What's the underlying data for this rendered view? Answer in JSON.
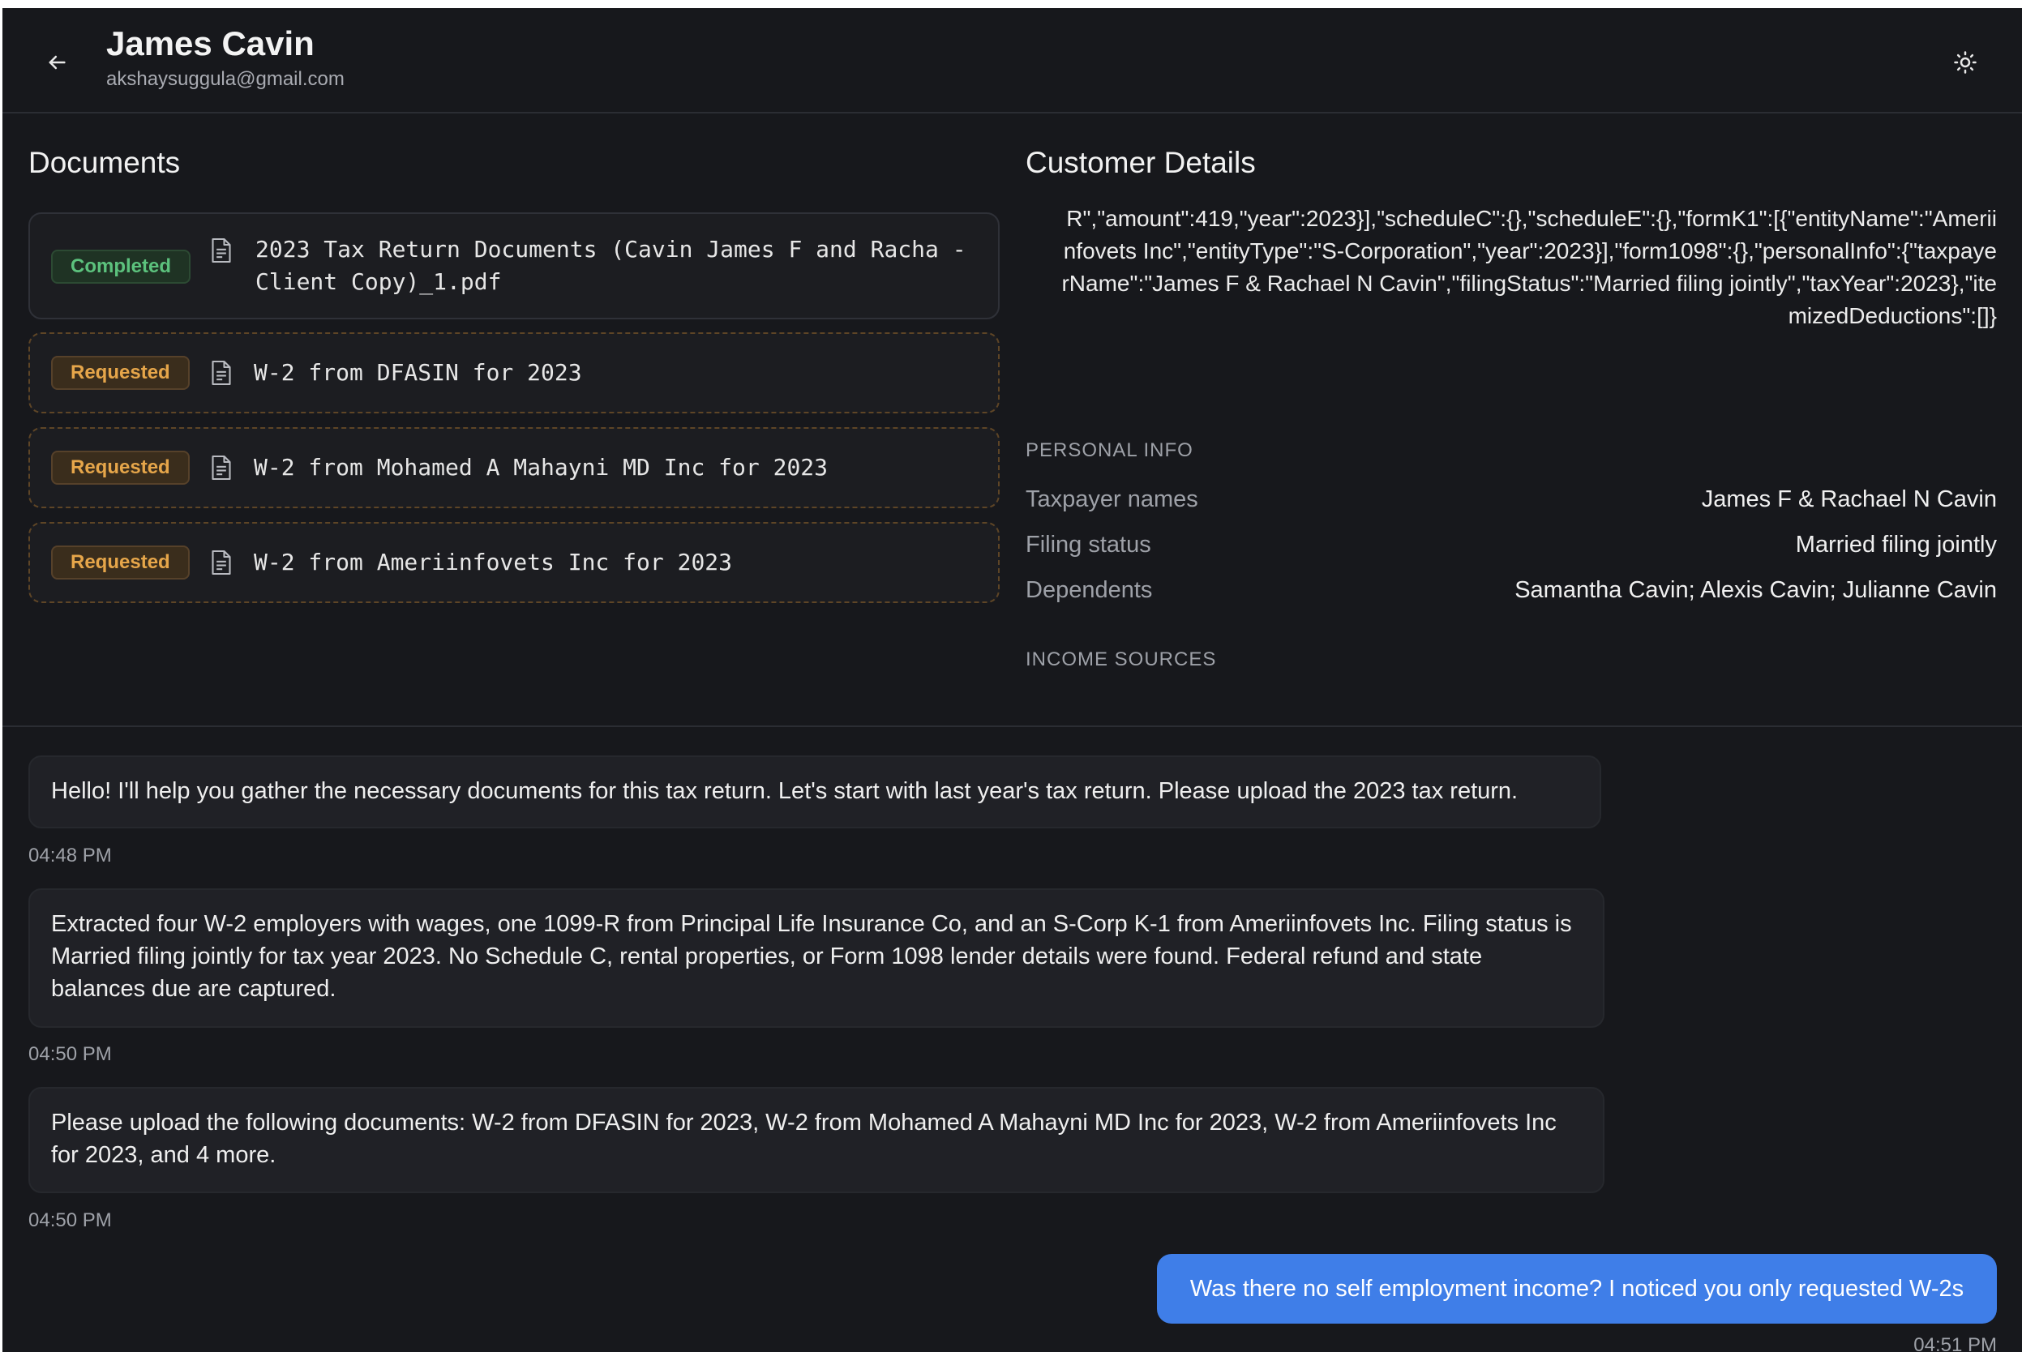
{
  "header": {
    "title": "James Cavin",
    "email": "akshaysuggula@gmail.com",
    "back_icon": "arrow-left-icon",
    "theme_icon": "sun-icon"
  },
  "documents": {
    "title": "Documents",
    "items": [
      {
        "status": "Completed",
        "name": "2023 Tax Return Documents (Cavin James F and Racha -\nClient Copy)_1.pdf"
      },
      {
        "status": "Requested",
        "name": "W-2 from DFASIN for 2023"
      },
      {
        "status": "Requested",
        "name": "W-2 from Mohamed A Mahayni MD Inc for 2023"
      },
      {
        "status": "Requested",
        "name": "W-2 from Ameriinfovets Inc for 2023"
      }
    ]
  },
  "customer": {
    "title": "Customer Details",
    "raw_json_text": "R\",\"amount\":419,\"year\":2023}],\"scheduleC\":{},\"scheduleE\":{},\"formK1\":[{\"entityName\":\"Ameriinfovets Inc\",\"entityType\":\"S-Corporation\",\"year\":2023}],\"form1098\":{},\"personalInfo\":{\"taxpayerName\":\"James F & Rachael N Cavin\",\"filingStatus\":\"Married filing jointly\",\"taxYear\":2023},\"itemizedDeductions\":[]}",
    "personal_info_label": "PERSONAL INFO",
    "personal_info": [
      {
        "key": "Taxpayer names",
        "value": "James F & Rachael N Cavin"
      },
      {
        "key": "Filing status",
        "value": "Married filing jointly"
      },
      {
        "key": "Dependents",
        "value": "Samantha Cavin; Alexis Cavin; Julianne Cavin"
      }
    ],
    "income_sources_label": "INCOME SOURCES"
  },
  "chat": {
    "messages": [
      {
        "text": "Hello! I'll help you gather the necessary documents for this tax return. Let's start with last year's tax return. Please upload the 2023 tax return.",
        "time": "04:48 PM"
      },
      {
        "text": "Extracted four W-2 employers with wages, one 1099-R from Principal Life Insurance Co, and an S-Corp K-1 from Ameriinfovets Inc. Filing status is Married filing jointly for tax year 2023. No Schedule C, rental properties, or Form 1098 lender details were found. Federal refund and state balances due are captured.",
        "time": "04:50 PM"
      },
      {
        "text": "Please upload the following documents: W-2 from DFASIN for 2023, W-2 from Mohamed A Mahayni MD Inc for 2023, W-2 from Ameriinfovets Inc for 2023, and 4 more.",
        "time": "04:50 PM"
      }
    ],
    "user_message": {
      "text": "Was there no self employment income? I noticed you only requested W-2s",
      "time": "04:51 PM"
    }
  },
  "colors": {
    "background": "#17181c",
    "completed": "#5cc27d",
    "requested": "#e6a64a",
    "user_bubble": "#3f7ee8"
  }
}
